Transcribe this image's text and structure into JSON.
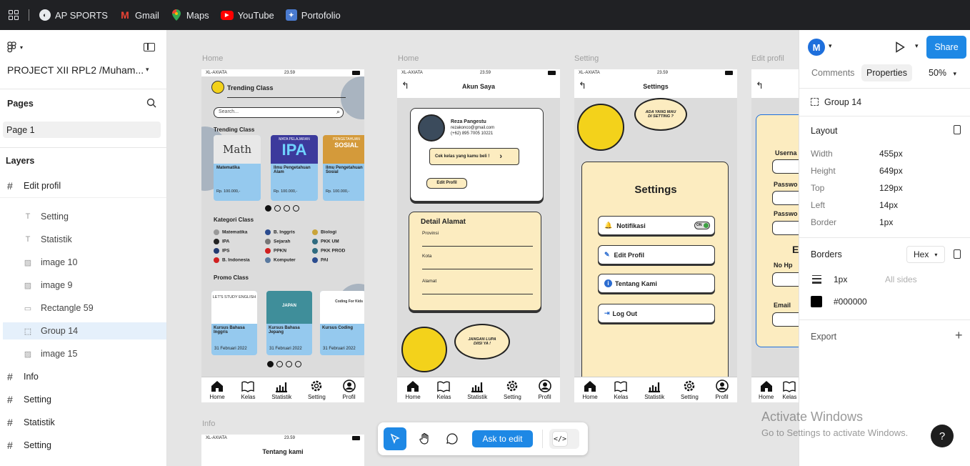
{
  "bookmarks": [
    {
      "label": "AP SPORTS",
      "icon": "globe-icon",
      "color": "#e8eaed"
    },
    {
      "label": "Gmail",
      "icon": "gmail-icon",
      "color": "#ea4335"
    },
    {
      "label": "Maps",
      "icon": "maps-icon",
      "color": "#34a853"
    },
    {
      "label": "YouTube",
      "icon": "youtube-icon",
      "color": "#ff0000"
    },
    {
      "label": "Portofolio",
      "icon": "portfolio-icon",
      "color": "#4a7bd0"
    }
  ],
  "sidebar": {
    "project_name": "PROJECT XII RPL2 /Muham...",
    "pages_title": "Pages",
    "page_item": "Page 1",
    "layers_title": "Layers",
    "layers": [
      {
        "label": "Edit profil",
        "kind": "frame"
      },
      {
        "label": "Setting",
        "kind": "text"
      },
      {
        "label": "Statistik",
        "kind": "text"
      },
      {
        "label": "image 10",
        "kind": "image"
      },
      {
        "label": "image 9",
        "kind": "image"
      },
      {
        "label": "Rectangle 59",
        "kind": "rect"
      },
      {
        "label": "Group 14",
        "kind": "group",
        "selected": true
      },
      {
        "label": "image 15",
        "kind": "image"
      },
      {
        "label": "Info",
        "kind": "frame"
      },
      {
        "label": "Setting",
        "kind": "frame"
      },
      {
        "label": "Statistik",
        "kind": "frame"
      },
      {
        "label": "Setting",
        "kind": "frame"
      }
    ]
  },
  "canvas": {
    "frame_labels": [
      "Home",
      "Home",
      "Setting",
      "Edit profil",
      "Info"
    ],
    "status": {
      "carrier": "XL-AXIATA",
      "time": "23.59"
    },
    "nav_items": [
      "Home",
      "Kelas",
      "Statistik",
      "Setting",
      "Profil"
    ],
    "home": {
      "title": "Trending Class",
      "search_placeholder": "Search...",
      "trending_title": "Trending Class",
      "trending_cards": [
        {
          "name": "Matematika",
          "price": "Rp. 100.000,-",
          "thumb": "Math",
          "color": "#e8e8e8"
        },
        {
          "name": "Ilmu Pengetahuan Alam",
          "price": "Rp. 100.000,-",
          "thumb": "IPA",
          "color": "#3c3a9c",
          "sub": "MATA PELAJARAN"
        },
        {
          "name": "Ilmu Pengetahuan Sosial",
          "price": "Rp. 100.000,-",
          "thumb": "SOSIAL",
          "color": "#d49a3a",
          "sub": "PENGETAHUAN"
        }
      ],
      "kategori_title": "Kategori Class",
      "kategori": [
        "Matematika",
        "B. Inggris",
        "Biologi",
        "IPA",
        "Sejarah",
        "PKK UM",
        "IPS",
        "PPKN",
        "PKK PROD",
        "B. Indonesia",
        "Komputer",
        "PAI"
      ],
      "promo_title": "Promo Class",
      "promo_cards": [
        {
          "name": "Kursus Bahasa Inggris",
          "date": "31 Februari 2022",
          "thumb": "LET'S STUDY ENGLISH"
        },
        {
          "name": "Kursus Bahasa Jepang",
          "date": "31 Februari 2022",
          "thumb": "JAPAN"
        },
        {
          "name": "Kursus Coding",
          "date": "31 Februari 2022",
          "thumb": "Coding For Kids"
        }
      ]
    },
    "akun": {
      "title": "Akun Saya",
      "name": "Reza Pangestu",
      "email": "rezakonco@gmail.com",
      "phone": "(+62) 895 7005 10221",
      "cek_kelas": "Cek kelas yang kamu beli !",
      "edit_profil": "Edit Profil",
      "alamat_title": "Detail Alamat",
      "fields": [
        "Provinsi",
        "Kota",
        "Alamat"
      ],
      "bubble": "JANGAN LUPA DIISI YA !"
    },
    "setting": {
      "title": "Settings",
      "heading": "Settings",
      "bubble": "ADA YANG MAU DI SETTING ?",
      "items": [
        "Notifikasi",
        "Edit Profil",
        "Tentang Kami",
        "Log Out"
      ],
      "toggle": "ON"
    },
    "edit": {
      "labels": [
        "Userna",
        "Passwo",
        "Passwo",
        "No Hp",
        "Email"
      ],
      "heading_letter": "E"
    },
    "info": {
      "title": "Tentang kami"
    }
  },
  "toolbar": {
    "ask_label": "Ask to edit"
  },
  "right": {
    "avatar_letter": "M",
    "avatar_color": "#1e6fdc",
    "share_label": "Share",
    "tabs": [
      "Comments",
      "Properties"
    ],
    "zoom": "50%",
    "selection": "Group 14",
    "layout_title": "Layout",
    "props": [
      {
        "label": "Width",
        "value": "455px"
      },
      {
        "label": "Height",
        "value": "649px"
      },
      {
        "label": "Top",
        "value": "129px"
      },
      {
        "label": "Left",
        "value": "14px"
      },
      {
        "label": "Border",
        "value": "1px"
      }
    ],
    "borders_title": "Borders",
    "color_mode": "Hex",
    "border_width": "1px",
    "border_sides": "All sides",
    "border_color": "#000000",
    "export_title": "Export"
  },
  "watermark": {
    "line1": "Activate Windows",
    "line2": "Go to Settings to activate Windows."
  },
  "help_label": "?"
}
